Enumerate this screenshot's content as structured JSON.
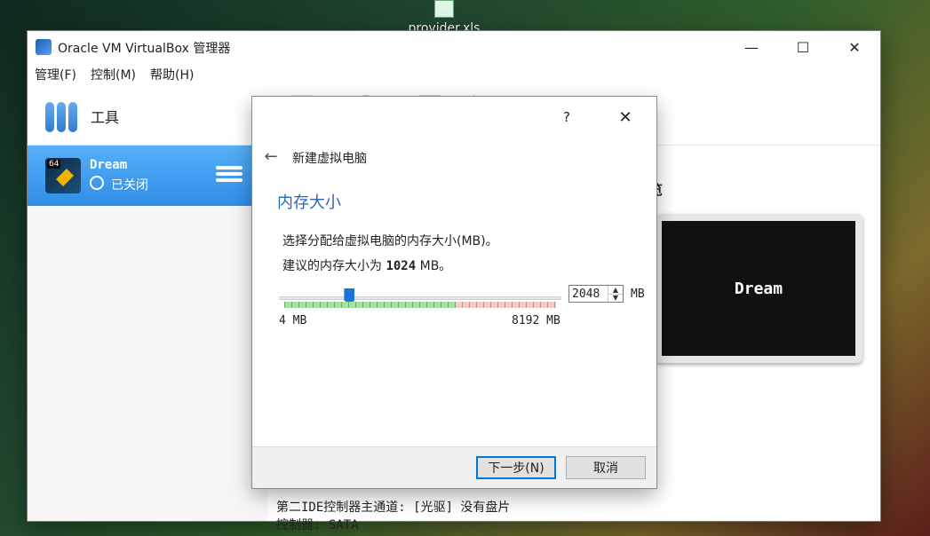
{
  "desktop": {
    "file_name": "provider.xls"
  },
  "window": {
    "title": "Oracle VM VirtualBox 管理器",
    "controls": {
      "minimize": "—",
      "maximize": "☐",
      "close": "✕"
    }
  },
  "menu": {
    "items": [
      "管理(F)",
      "控制(M)",
      "帮助(H)"
    ]
  },
  "left": {
    "tools_label": "工具",
    "vm": {
      "name": "Dream",
      "status": "已关闭",
      "bits_badge": "64"
    }
  },
  "right": {
    "preview_title": "览",
    "preview_screen_text": "Dream",
    "details_line1": "第二IDE控制器主通道: [光驱] 没有盘片",
    "details_line2": "控制器: SATA"
  },
  "dialog": {
    "help": "?",
    "close": "✕",
    "back": "←",
    "title": "新建虚拟电脑",
    "header": "内存大小",
    "desc1": "选择分配给虚拟电脑的内存大小(MB)。",
    "desc2_prefix": "建议的内存大小为 ",
    "desc2_value": "1024",
    "desc2_suffix": " MB。",
    "memory": {
      "value": 2048,
      "min": 4,
      "max": 8192,
      "unit": "MB"
    },
    "labels": {
      "min": "4 MB",
      "max": "8192 MB",
      "spin_unit": "MB"
    },
    "buttons": {
      "next": "下一步(N)",
      "cancel": "取消"
    }
  },
  "colors": {
    "accent": "#2e66b8",
    "selection": "#3a96ee",
    "slider_thumb": "#1e74d6"
  }
}
